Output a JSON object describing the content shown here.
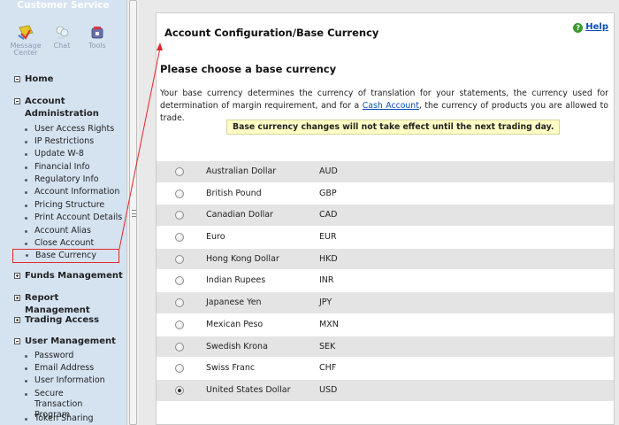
{
  "sidebar": {
    "title": "Customer Service",
    "tools": {
      "message_center": "Message Center",
      "chat": "Chat",
      "tools": "Tools"
    },
    "sections": {
      "home": "Home",
      "account_admin": "Account Administration",
      "funds": "Funds Management",
      "report": "Report Management",
      "trading": "Trading Access",
      "user_mgmt": "User Management"
    },
    "account_admin_items": [
      "User Access Rights",
      "IP Restrictions",
      "Update W-8",
      "Financial Info",
      "Regulatory Info",
      "Account Information",
      "Pricing Structure",
      "Print Account Details",
      "Account Alias",
      "Close Account",
      "Base Currency"
    ],
    "user_mgmt_items": [
      "Password",
      "Email Address",
      "User Information",
      "Secure Transaction Program",
      "Token Sharing"
    ]
  },
  "main": {
    "title": "Account Configuration/Base Currency",
    "help_label": "Help",
    "subtitle": "Please choose a base currency",
    "desc_before": "Your base currency determines the currency of translation for your statements, the currency used for determination of margin requirement, and for a ",
    "desc_link": "Cash Account",
    "desc_after": ", the currency of products you are allowed to trade.",
    "warning": "Base currency changes will not take effect until the next trading day.",
    "currencies": [
      {
        "name": "Australian Dollar",
        "code": "AUD",
        "selected": false
      },
      {
        "name": "British Pound",
        "code": "GBP",
        "selected": false
      },
      {
        "name": "Canadian Dollar",
        "code": "CAD",
        "selected": false
      },
      {
        "name": "Euro",
        "code": "EUR",
        "selected": false
      },
      {
        "name": "Hong Kong Dollar",
        "code": "HKD",
        "selected": false
      },
      {
        "name": "Indian Rupees",
        "code": "INR",
        "selected": false
      },
      {
        "name": "Japanese Yen",
        "code": "JPY",
        "selected": false
      },
      {
        "name": "Mexican Peso",
        "code": "MXN",
        "selected": false
      },
      {
        "name": "Swedish Krona",
        "code": "SEK",
        "selected": false
      },
      {
        "name": "Swiss Franc",
        "code": "CHF",
        "selected": false
      },
      {
        "name": "United States Dollar",
        "code": "USD",
        "selected": true
      }
    ]
  },
  "colors": {
    "sidebar_bg": "#d5e3f1",
    "highlight_red": "#e2262a",
    "link_blue": "#0a4dbd",
    "warning_bg": "#ffffc6",
    "row_alt": "#e4e4e4"
  }
}
